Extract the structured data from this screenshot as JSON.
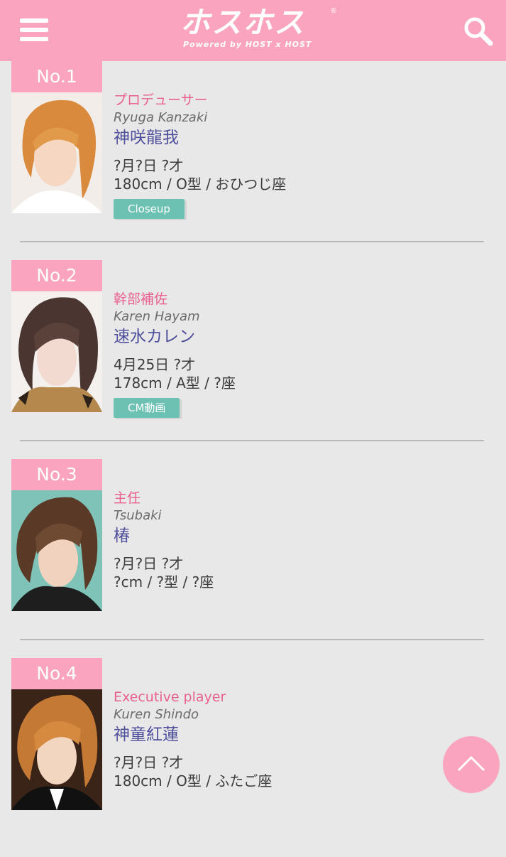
{
  "header": {
    "menu_icon": "hamburger-menu-icon",
    "logo_text": "ホスホス",
    "logo_reg": "®",
    "logo_tagline": "Powered by HOST x HOST",
    "search_icon": "search-icon",
    "color": "#fba4bf"
  },
  "hosts": [
    {
      "rank": "No.1",
      "role": "プロデューサー",
      "romaji": "Ryuga Kanzaki",
      "name": "神咲龍我",
      "birth_age": "?月?日 ?才",
      "stats": "180cm / O型 / おひつじ座",
      "button": "Closeup"
    },
    {
      "rank": "No.2",
      "role": "幹部補佐",
      "romaji": "Karen Hayam",
      "name": "速水カレン",
      "birth_age": "4月25日 ?才",
      "stats": "178cm / A型 / ?座",
      "button": "CM動画"
    },
    {
      "rank": "No.3",
      "role": "主任",
      "romaji": "Tsubaki",
      "name": "椿",
      "birth_age": "?月?日 ?才",
      "stats": "?cm / ?型 / ?座"
    },
    {
      "rank": "No.4",
      "role": "Executive player",
      "romaji": "Kuren Shindo",
      "name": "神童紅蓮",
      "birth_age": "?月?日 ?才",
      "stats": "180cm / O型 / ふたご座"
    }
  ],
  "scroll_top_icon": "chevron-up-icon",
  "colors": {
    "accent": "#fba4bf",
    "role": "#e96191",
    "name": "#4f4f9c",
    "button": "#6cc1b3"
  }
}
